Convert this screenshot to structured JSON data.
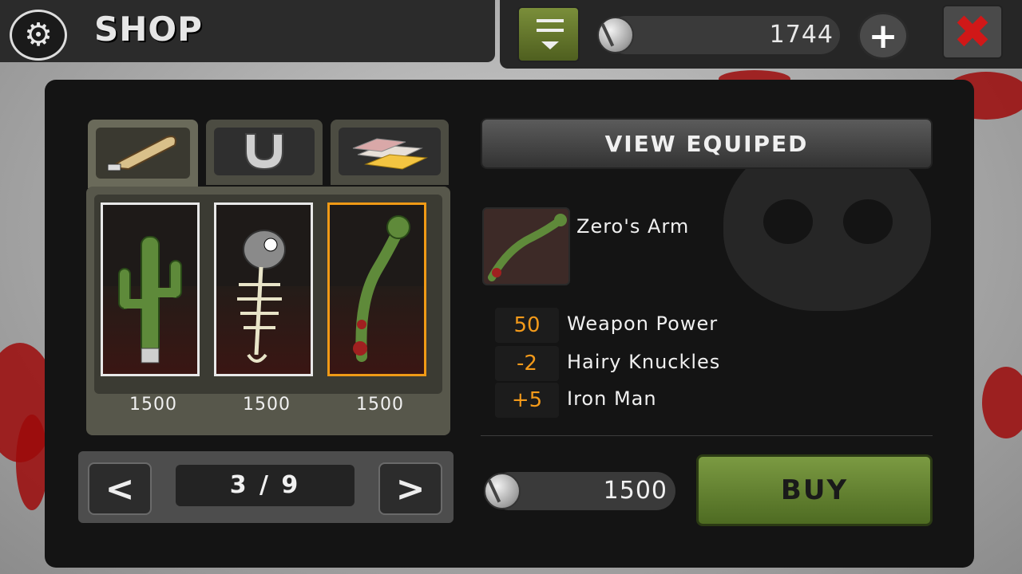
{
  "header": {
    "title": "SHOP",
    "coins": "1744",
    "plus_label": "+",
    "close_label": "✖"
  },
  "tabs": [
    {
      "name": "weapons",
      "icon": "bat-icon",
      "active": true
    },
    {
      "name": "accessories",
      "icon": "horseshoe-icon",
      "active": false
    },
    {
      "name": "gold",
      "icon": "gold-bars-icon",
      "active": false
    }
  ],
  "items": [
    {
      "name": "cactus",
      "icon": "cactus-weapon-icon",
      "price": "1500",
      "selected": false
    },
    {
      "name": "fish-skeleton",
      "icon": "fish-skeleton-weapon-icon",
      "price": "1500",
      "selected": false
    },
    {
      "name": "zeros-arm",
      "icon": "zombie-arm-weapon-icon",
      "price": "1500",
      "selected": true
    }
  ],
  "pager": {
    "prev_label": "<",
    "next_label": ">",
    "indicator": "3 / 9",
    "current": 3,
    "total": 9
  },
  "details": {
    "view_equiped_label": "VIEW EQUIPED",
    "item_name": "Zero's Arm",
    "stats": [
      {
        "value": "50",
        "label": "Weapon Power"
      },
      {
        "value": "-2",
        "label": "Hairy Knuckles"
      },
      {
        "value": "+5",
        "label": "Iron Man"
      }
    ],
    "price": "1500",
    "buy_label": "BUY"
  },
  "colors": {
    "accent_orange": "#f09a16",
    "buy_green": "#6b8a34",
    "blood_red": "#9c0a0a"
  }
}
